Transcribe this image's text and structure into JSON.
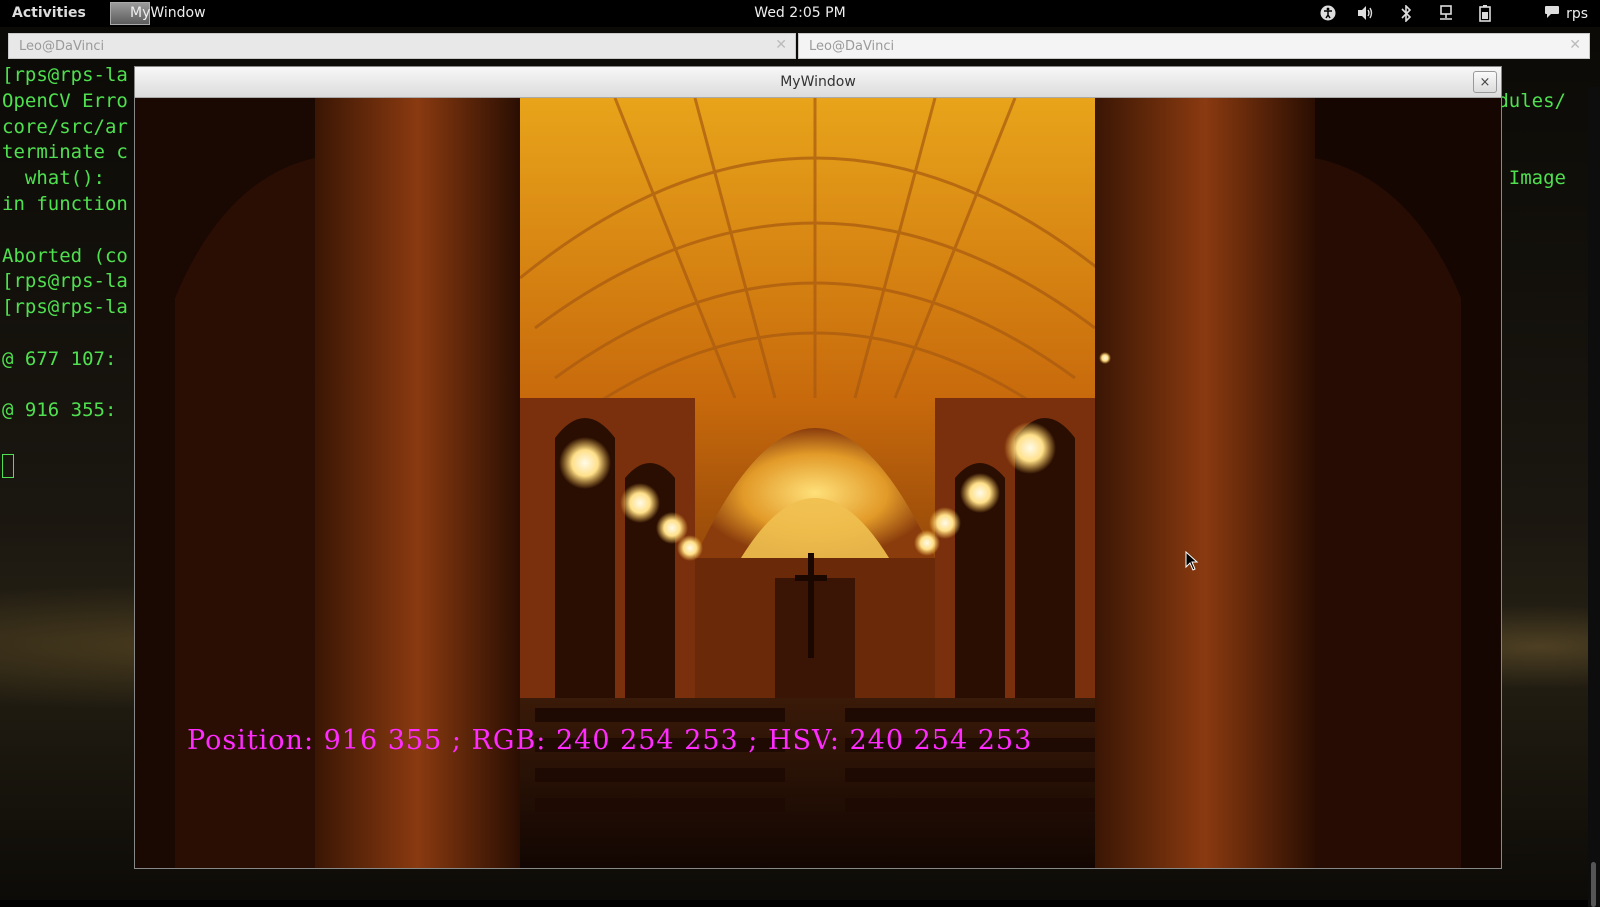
{
  "topbar": {
    "activities": "Activities",
    "app_name": "MyWindow",
    "clock": "Wed  2:05 PM",
    "user": "rps",
    "tray_icons": [
      "accessibility-icon",
      "volume-icon",
      "bluetooth-icon",
      "network-icon",
      "battery-icon",
      "chat-icon"
    ]
  },
  "terminal": {
    "tabs": [
      {
        "label": "Leo@DaVinci"
      },
      {
        "label": "Leo@DaVinci"
      }
    ],
    "lines": [
      "[rps@rps-la",
      "OpenCV Erro",
      "core/src/ar",
      "terminate c",
      "  what():",
      "in function",
      "",
      "Aborted (co",
      "[rps@rps-la",
      "[rps@rps-la",
      "",
      "@ 677 107:",
      "",
      "@ 916 355:"
    ],
    "right_fragments": [
      "dules/",
      "",
      "",
      "Image"
    ],
    "text_color": "#4fe04f"
  },
  "cv_window": {
    "title": "MyWindow",
    "close_label": "×",
    "overlay": "Position: 916 355 ; RGB: 240 254 253 ; HSV: 240 254 253",
    "overlay_color": "#ff2bff"
  }
}
